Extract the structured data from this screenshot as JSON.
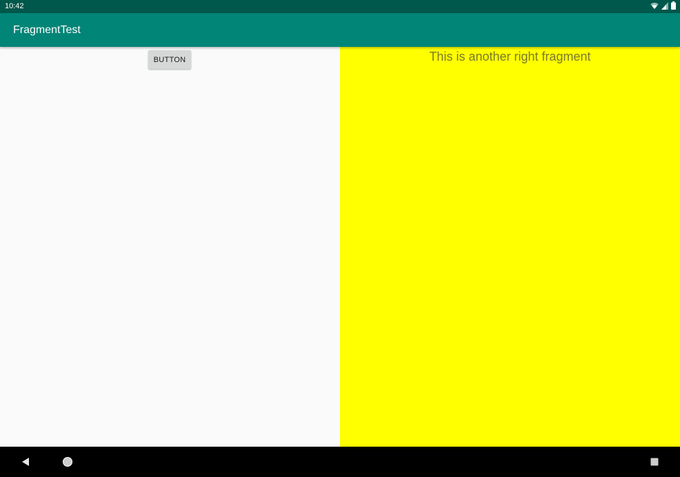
{
  "status_bar": {
    "time": "10:42",
    "icons": [
      "wifi-icon",
      "cell-signal-icon",
      "battery-icon"
    ],
    "background_color": "#00574b"
  },
  "app_bar": {
    "title": "FragmentTest",
    "background_color": "#008577"
  },
  "left_fragment": {
    "button_label": "BUTTON"
  },
  "right_fragment": {
    "text": "This is another right fragment",
    "background_color": "#ffff00"
  },
  "nav_bar": {
    "buttons": [
      "back-icon",
      "home-icon",
      "recents-icon"
    ]
  }
}
